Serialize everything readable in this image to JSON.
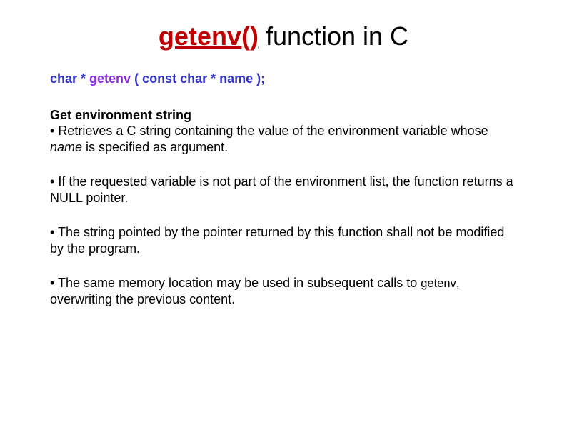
{
  "title": {
    "func": "getenv()",
    "rest": " function in C"
  },
  "signature": {
    "prefix": "char *  ",
    "fn": "getenv",
    "suffix": " ( const char * name );"
  },
  "section_head": "Get environment string",
  "bullets": {
    "b1_a": "Retrieves a C string containing the value of the environment variable whose ",
    "b1_i": "name",
    "b1_b": " is specified as argument.",
    "b2": "If the requested variable is not part of the environment list, the function returns a NULL pointer.",
    "b3": "The string pointed by the pointer returned by this function shall not be modified by the program.",
    "b4_a": "The same memory location may be used in subsequent calls to ",
    "b4_code": "getenv",
    "b4_b": ", overwriting the previous content."
  }
}
